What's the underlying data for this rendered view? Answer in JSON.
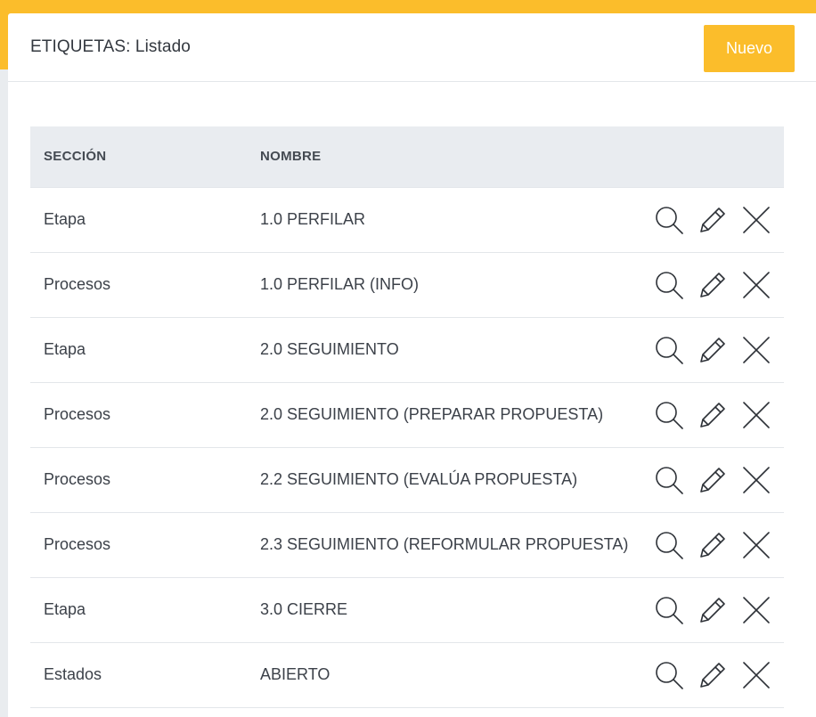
{
  "header": {
    "title": "ETIQUETAS: Listado",
    "new_button_label": "Nuevo"
  },
  "colors": {
    "accent": "#fbbd2b",
    "header_row_bg": "#e9ecf0",
    "text": "#3c4149"
  },
  "table": {
    "columns": [
      "SECCIÓN",
      "NOMBRE"
    ],
    "actions_icons": [
      "search-icon",
      "pencil-icon",
      "close-icon"
    ],
    "rows": [
      {
        "seccion": "Etapa",
        "nombre": "1.0 PERFILAR"
      },
      {
        "seccion": "Procesos",
        "nombre": "1.0 PERFILAR (INFO)"
      },
      {
        "seccion": "Etapa",
        "nombre": "2.0 SEGUIMIENTO"
      },
      {
        "seccion": "Procesos",
        "nombre": "2.0 SEGUIMIENTO (PREPARAR PROPUESTA)"
      },
      {
        "seccion": "Procesos",
        "nombre": "2.2 SEGUIMIENTO (EVALÚA PROPUESTA)"
      },
      {
        "seccion": "Procesos",
        "nombre": "2.3 SEGUIMIENTO (REFORMULAR PROPUESTA)"
      },
      {
        "seccion": "Etapa",
        "nombre": "3.0 CIERRE"
      },
      {
        "seccion": "Estados",
        "nombre": "ABIERTO"
      }
    ]
  }
}
